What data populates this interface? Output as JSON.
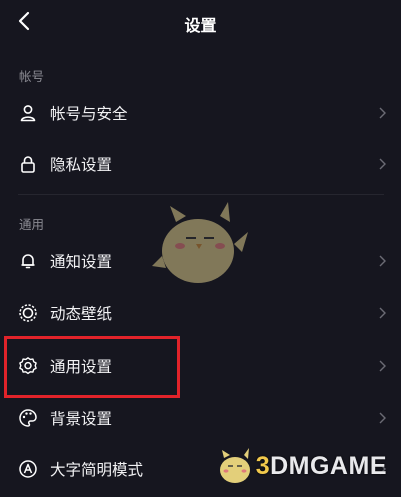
{
  "header": {
    "title": "设置"
  },
  "sections": [
    {
      "label": "帐号",
      "items": [
        {
          "label": "帐号与安全",
          "icon": "person-icon"
        },
        {
          "label": "隐私设置",
          "icon": "lock-icon"
        }
      ]
    },
    {
      "label": "通用",
      "items": [
        {
          "label": "通知设置",
          "icon": "bell-icon"
        },
        {
          "label": "动态壁纸",
          "icon": "wallpaper-icon"
        },
        {
          "label": "通用设置",
          "icon": "gear-icon"
        },
        {
          "label": "背景设置",
          "icon": "palette-icon"
        },
        {
          "label": "大字简明模式",
          "icon": "text-mode-icon"
        }
      ]
    }
  ],
  "watermark": {
    "text_prefix": "3",
    "text_rest": "DMGAME"
  },
  "colors": {
    "background": "#16161f",
    "highlight": "#e1232a",
    "secondary_text": "#8b8b93"
  }
}
